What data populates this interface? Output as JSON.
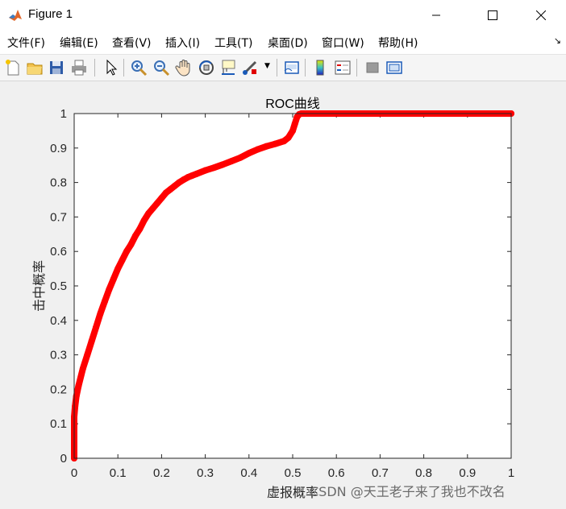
{
  "window": {
    "title": "Figure 1",
    "controls": [
      "minimize-icon",
      "maximize-icon",
      "close-icon"
    ]
  },
  "menu": {
    "items": [
      {
        "label": "文件(F)"
      },
      {
        "label": "编辑(E)"
      },
      {
        "label": "查看(V)"
      },
      {
        "label": "插入(I)"
      },
      {
        "label": "工具(T)"
      },
      {
        "label": "桌面(D)"
      },
      {
        "label": "窗口(W)"
      },
      {
        "label": "帮助(H)"
      }
    ],
    "overflow_icon": "menu-collapse-arrow-icon"
  },
  "toolbar": {
    "icons": [
      "new-figure-icon",
      "open-file-icon",
      "save-icon",
      "print-icon",
      "pointer-icon",
      "zoom-in-icon",
      "zoom-out-icon",
      "pan-hand-icon",
      "rotate-3d-icon",
      "data-cursor-icon",
      "brush-icon",
      "link-plot-icon",
      "colorbar-icon",
      "legend-icon",
      "hide-plot-tools-icon",
      "show-plot-tools-icon"
    ]
  },
  "chart_data": {
    "type": "line",
    "title": "ROC曲线",
    "xlabel": "虚报概率",
    "ylabel": "击中概率",
    "xlim": [
      0,
      1
    ],
    "ylim": [
      0,
      1
    ],
    "xticks": [
      "0",
      "0.1",
      "0.2",
      "0.3",
      "0.4",
      "0.5",
      "0.6",
      "0.7",
      "0.8",
      "0.9",
      "1"
    ],
    "yticks": [
      "0",
      "0.1",
      "0.2",
      "0.3",
      "0.4",
      "0.5",
      "0.6",
      "0.7",
      "0.8",
      "0.9",
      "1"
    ],
    "grid": false,
    "series": [
      {
        "color": "#ff0000",
        "x": [
          0,
          0,
          0.002,
          0.005,
          0.01,
          0.02,
          0.03,
          0.04,
          0.05,
          0.06,
          0.07,
          0.08,
          0.09,
          0.1,
          0.11,
          0.12,
          0.13,
          0.14,
          0.15,
          0.16,
          0.17,
          0.18,
          0.19,
          0.2,
          0.21,
          0.22,
          0.23,
          0.24,
          0.25,
          0.26,
          0.27,
          0.28,
          0.3,
          0.32,
          0.34,
          0.36,
          0.38,
          0.4,
          0.42,
          0.44,
          0.46,
          0.48,
          0.49,
          0.5,
          0.505,
          0.51,
          0.515,
          0.52,
          0.53,
          0.55,
          0.6,
          0.7,
          0.8,
          0.9,
          1
        ],
        "y": [
          0,
          0.12,
          0.15,
          0.18,
          0.21,
          0.26,
          0.3,
          0.34,
          0.38,
          0.42,
          0.455,
          0.49,
          0.52,
          0.55,
          0.575,
          0.6,
          0.62,
          0.645,
          0.665,
          0.69,
          0.71,
          0.725,
          0.74,
          0.755,
          0.77,
          0.78,
          0.79,
          0.8,
          0.808,
          0.815,
          0.82,
          0.825,
          0.835,
          0.843,
          0.852,
          0.862,
          0.872,
          0.885,
          0.896,
          0.905,
          0.912,
          0.92,
          0.93,
          0.95,
          0.97,
          0.99,
          0.998,
          1,
          1,
          1,
          1,
          1,
          1,
          1,
          1
        ]
      }
    ]
  },
  "watermark": "CSDN @天王老子来了我也不改名"
}
